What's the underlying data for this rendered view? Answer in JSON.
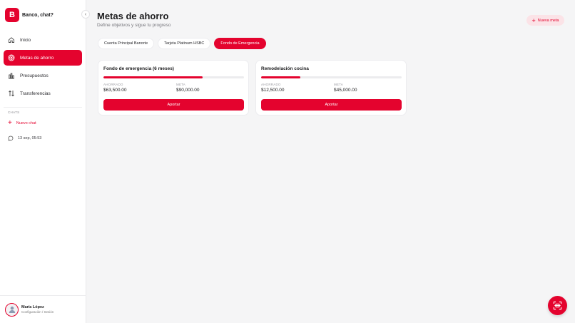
{
  "brand": {
    "logo_letter": "B",
    "name": "Banco, chat?"
  },
  "nav": {
    "items": [
      {
        "label": "Inicio",
        "icon": "home-icon",
        "active": false
      },
      {
        "label": "Metas de ahorro",
        "icon": "target-icon",
        "active": true
      },
      {
        "label": "Presupuestos",
        "icon": "bar-chart-icon",
        "active": false
      },
      {
        "label": "Transferencias",
        "icon": "transfer-arrows-icon",
        "active": false
      }
    ]
  },
  "chats": {
    "title": "CHATS",
    "new_chat": "Nuevo chat",
    "items": [
      {
        "label": "13 sep, 05:53",
        "icon": "chat-bubble-icon"
      }
    ]
  },
  "user": {
    "name": "María López",
    "subtitle": "Configuración / Sesión"
  },
  "header": {
    "title": "Metas de ahorro",
    "subtitle": "Define objetivos y sigue tu progreso",
    "new_goal_label": "Nueva meta"
  },
  "tabs": [
    {
      "label": "Cuenta Principal Banorte",
      "active": false
    },
    {
      "label": "Tarjeta Platinum HSBC",
      "active": false
    },
    {
      "label": "Fondo de Emergencia",
      "active": true
    }
  ],
  "goals": [
    {
      "title": "Fondo de emergencia (6 meses)",
      "progress": 0.706,
      "saved_label": "AHORRADO",
      "saved_value": "$63,500.00",
      "target_label": "META",
      "target_value": "$90,000.00",
      "button_label": "Aportar"
    },
    {
      "title": "Remodelación cocina",
      "progress": 0.278,
      "saved_label": "AHORRADO",
      "saved_value": "$12,500.00",
      "target_label": "META",
      "target_value": "$45,000.00",
      "button_label": "Aportar"
    }
  ],
  "colors": {
    "accent": "#e4032e",
    "accent_soft": "#fbe3e7",
    "background": "#f5f5f6"
  },
  "fab": {
    "icon": "scan-icon"
  }
}
